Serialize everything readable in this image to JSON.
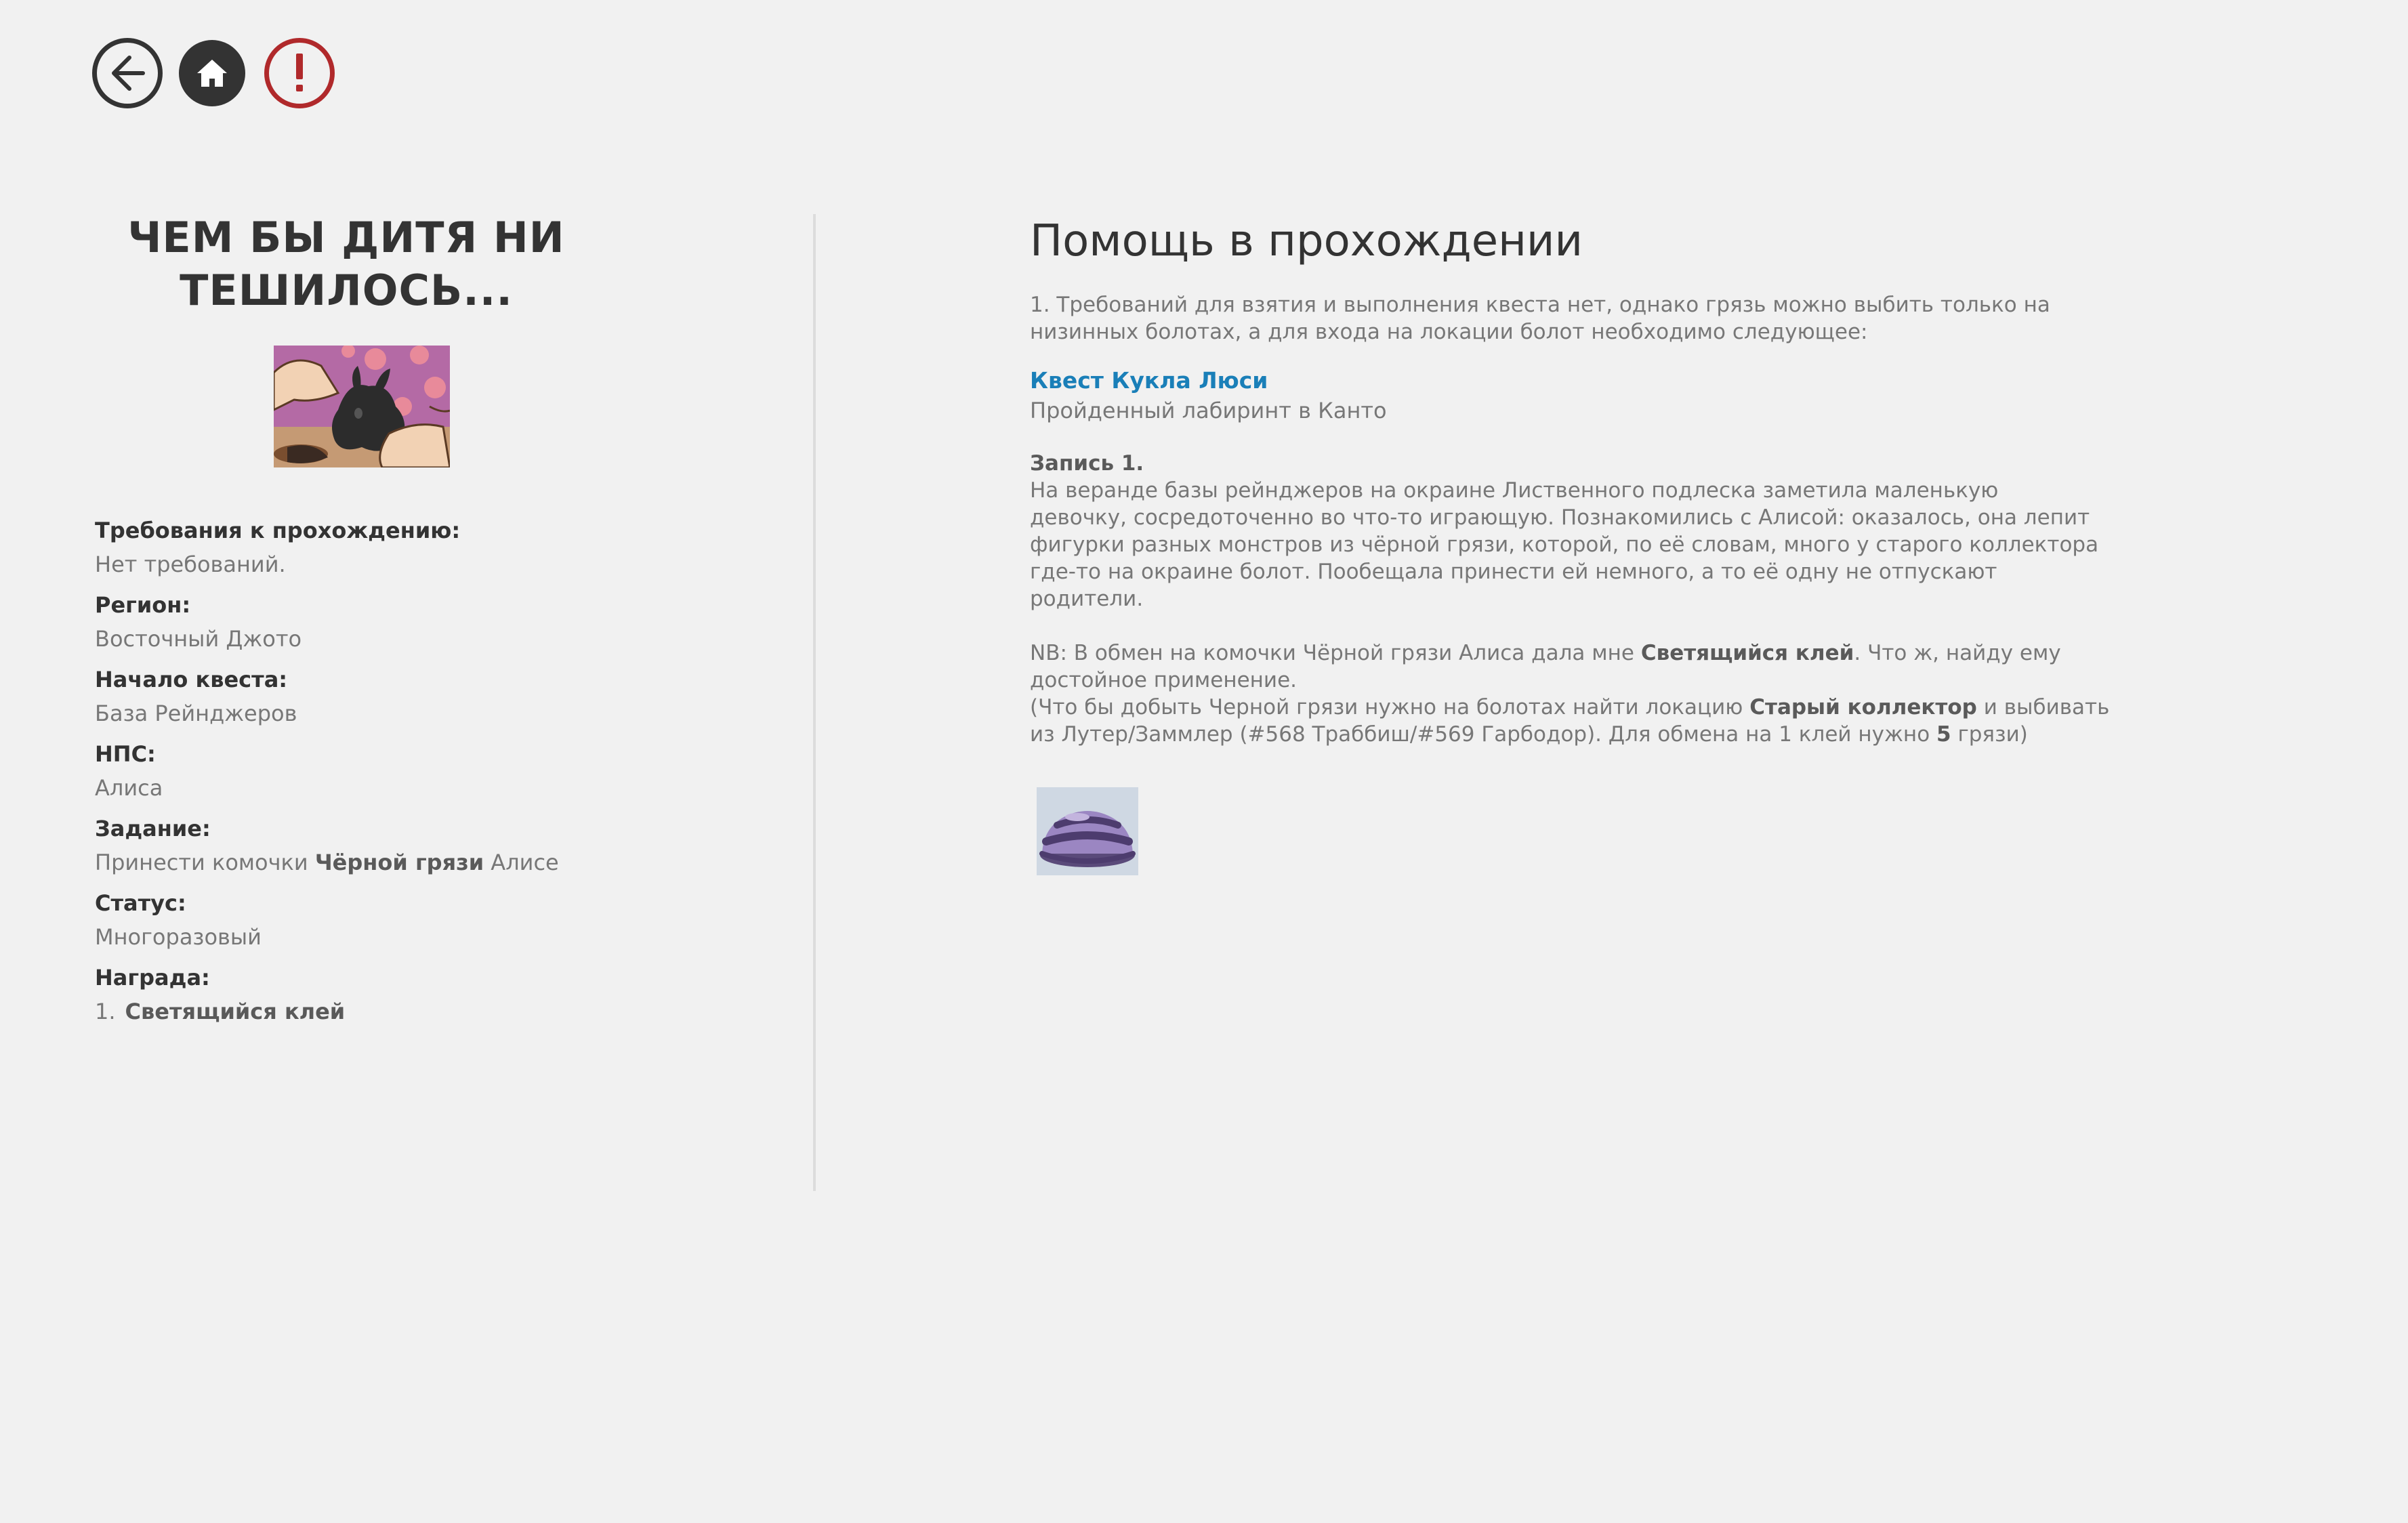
{
  "nav": {
    "back": "back-icon",
    "home": "home-icon",
    "alert": "alert-icon"
  },
  "colors": {
    "background": "#f1f1f1",
    "heading": "#333333",
    "text": "#777777",
    "link": "#1a7fb8",
    "alert": "#b0292b",
    "divider": "#dcdcdc"
  },
  "quest": {
    "title_line1": "ЧЕМ БЫ ДИТЯ НИ",
    "title_line2": "ТЕШИЛОСЬ..."
  },
  "info": {
    "requirements_label": "Требования к прохождению:",
    "requirements_value": "Нет требований.",
    "region_label": "Регион:",
    "region_value": "Восточный Джото",
    "start_label": "Начало квеста:",
    "start_value": "База Рейнджеров",
    "npc_label": "НПС:",
    "npc_value": "Алиса",
    "task_label": "Задание:",
    "task_prefix": "Принести комочки",
    "task_bold": "Чёрной грязи",
    "task_suffix": "Алисе",
    "status_label": "Статус:",
    "status_value": "Многоразовый",
    "reward_label": "Награда:",
    "reward_num": "1.",
    "reward_name": "Светящийся клей"
  },
  "help": {
    "title": "Помощь в прохождении",
    "intro_line1": "1. Требований для взятия и выполнения квеста нет, однако грязь можно выбить только на",
    "intro_line2": "низинных болотах, а для входа на локации болот необходимо следующее:",
    "link_label": "Квест Кукла Люси",
    "req2": "Пройденный лабиринт в Канто",
    "entry_title": "Запись 1.",
    "entry_line1": "На веранде базы рейнджеров на окраине Лиственного подлеска заметила маленькую",
    "entry_line2": "девочку, сосредоточенно во что-то играющую. Познакомились с Алисой: оказалось, она лепит",
    "entry_line3": "фигурки разных монстров из чёрной грязи, которой, по её словам, много у старого коллектора",
    "entry_line4": "где-то на окраине болот. Пообещала принести ей немного, а то её одну не отпускают",
    "entry_line5": "родители.",
    "nb_part1": "NB: В обмен на комочки Чёрной грязи Алиса дала мне",
    "nb_bold": "Светящийся клей",
    "nb_part2": ". Что ж, найду ему",
    "nb_line2": "достойное применение.",
    "hint_part1": "(Что бы добыть Черной грязи нужно на болотах найти локацию",
    "hint_bold": "Старый коллектор",
    "hint_part2": "и выбивать",
    "hint_line2_part1": "из Лутер/Заммлер (#568 Траббиш/#569 Гарбодор). Для обмена на 1 клей нужно",
    "hint_line2_bold": "5",
    "hint_line2_part2": "грязи)"
  },
  "images": {
    "quest_image": "quest-illustration-child-sculpting-black-mud",
    "glue_image": "glowing-glue-item-icon"
  }
}
